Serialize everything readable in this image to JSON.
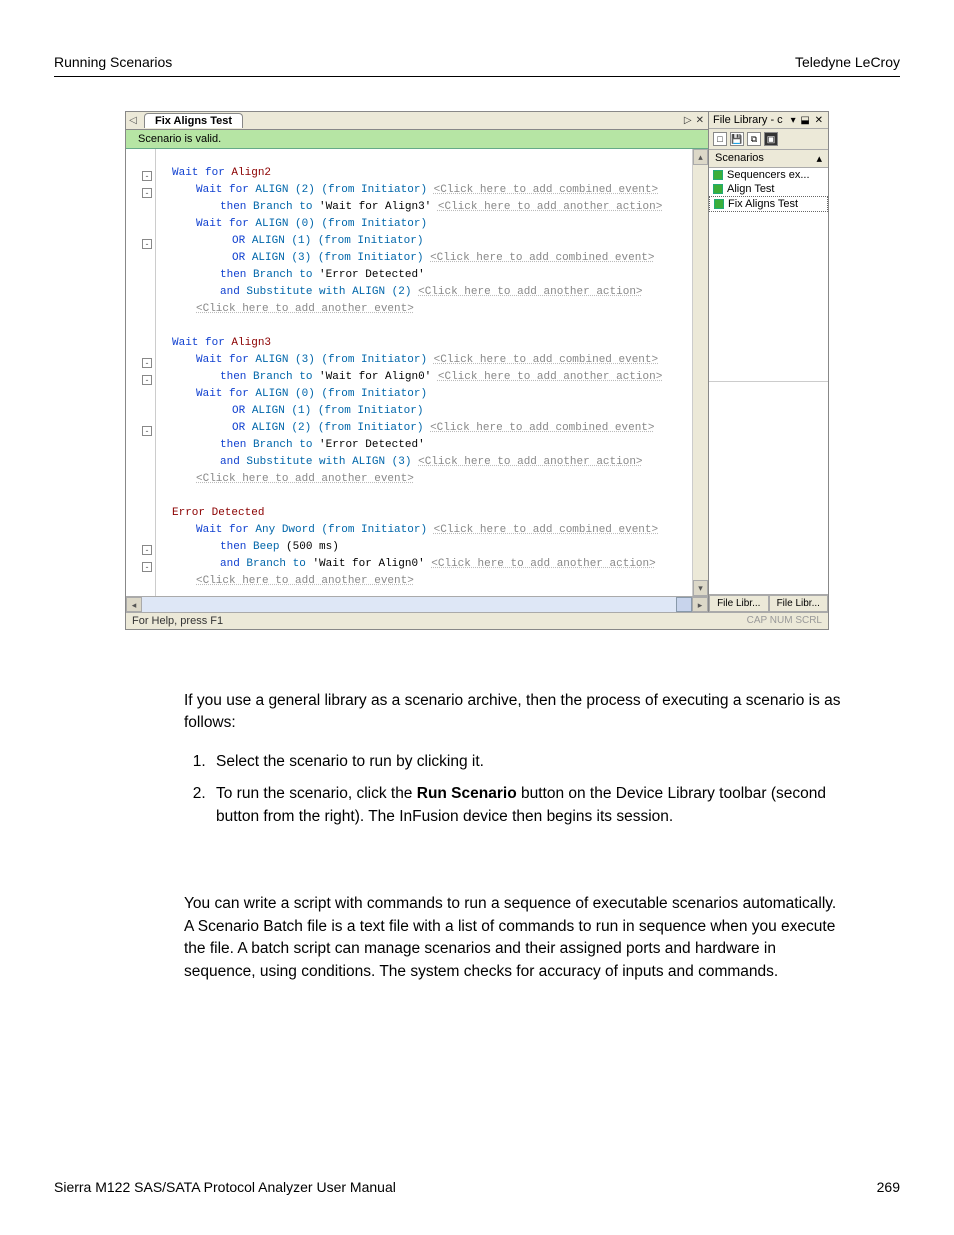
{
  "header": {
    "left": "Running Scenarios",
    "right": "Teledyne  LeCroy"
  },
  "footer": {
    "left": "Sierra M122 SAS/SATA Protocol Analyzer User Manual",
    "right": "269"
  },
  "ss": {
    "tab": "Fix Aligns Test",
    "tab_play": "▷",
    "tab_close": "✕",
    "tab_left": "◁",
    "valid": "Scenario is valid.",
    "status_left": "For Help, press F1",
    "status_right": "CAP  NUM  SCRL",
    "side": {
      "title": "File Library - c",
      "ctrls": "▾  ⬓  ✕",
      "header": "Scenarios",
      "items": [
        {
          "label": "Sequencers ex..."
        },
        {
          "label": "Align Test"
        },
        {
          "label": "Fix Aligns Test"
        }
      ],
      "tabs": [
        "File Libr...",
        "File Libr..."
      ]
    },
    "hints": {
      "combined": "<Click here to add combined event>",
      "action": "<Click here to add another action>",
      "event": "<Click here to add another event>"
    },
    "kw": {
      "wait": "Wait for",
      "then": "then",
      "or": "OR",
      "and": "and",
      "branch": "Branch to",
      "sub": "Substitute with",
      "beep": "Beep"
    },
    "sec": {
      "a2": "Align2",
      "a3": "Align3",
      "err": "Error Detected"
    },
    "vals": {
      "al2": "ALIGN (2) (from Initiator)",
      "al0": "ALIGN (0) (from Initiator)",
      "al1": "ALIGN (1) (from Initiator)",
      "al3": "ALIGN (3) (from Initiator)",
      "al2s": "ALIGN (2)",
      "al3s": "ALIGN (3)",
      "anyd": "Any Dword (from Initiator)",
      "beep": "(500 ms)",
      "targ_a3": "'Wait for Align3'",
      "targ_a0": "'Wait for Align0'",
      "targ_err": "'Error Detected'"
    }
  },
  "body": {
    "p1": "If you use a general library as a scenario archive, then the process of executing a scenario is as follows:",
    "li1": "Select the scenario to run by clicking it.",
    "li2a": "To run the scenario, click the ",
    "li2b": "Run Scenario",
    "li2c": " button on the Device Library toolbar (second button from the right). The InFusion device then begins its session.",
    "p2": "You can write a script with commands to run a sequence of executable scenarios automatically. A Scenario Batch file is a text file with a list of commands to run in sequence when you execute the file. A batch script can manage scenarios and their assigned ports and hardware in sequence, using conditions. The system checks for accuracy of inputs and commands."
  }
}
